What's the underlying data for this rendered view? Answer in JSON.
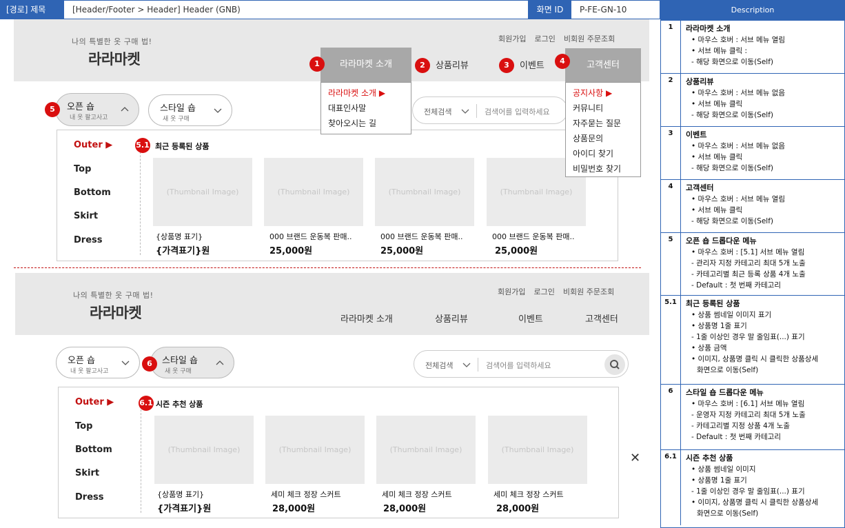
{
  "topbar": {
    "path_label": "[경로] 제목",
    "path": "[Header/Footer > Header] Header (GNB)",
    "id_label": "화면 ID",
    "id": "P-FE-GN-10"
  },
  "header1": {
    "slogan": "나의 특별한 옷 구매 법!",
    "logo": "라라마켓",
    "util": [
      "회원가입",
      "로그인",
      "비회원 주문조회"
    ],
    "nav": [
      "라라마켓 소개",
      "상품리뷰",
      "이벤트",
      "고객센터"
    ],
    "dd_about": [
      "라라마켓 소개 ▶",
      "대표인사말",
      "찾아오시는 길"
    ],
    "dd_cs": [
      "공지사항 ▶",
      "커뮤니티",
      "자주묻는 질문",
      "상품문의",
      "아이디 찾기",
      "비밀번호 찾기"
    ]
  },
  "header2": {
    "slogan": "나의 특별한 옷 구매 법!",
    "logo": "라라마켓",
    "util": [
      "회원가입",
      "로그인",
      "비회원 주문조회"
    ],
    "nav": [
      "라라마켓 소개",
      "상품리뷰",
      "이벤트",
      "고객센터"
    ]
  },
  "badges": [
    "1",
    "2",
    "3",
    "4",
    "5",
    "5.1",
    "6",
    "6.1"
  ],
  "pills": {
    "open": {
      "title": "오픈 숍",
      "sub": "내 옷 팔고사고"
    },
    "style": {
      "title": "스타일 숍",
      "sub": "새 옷 구매"
    }
  },
  "search": {
    "category": "전체검색",
    "placeholder": "검색어를 입력하세요"
  },
  "categories": [
    "Outer ▶",
    "Top",
    "Bottom",
    "Skirt",
    "Dress"
  ],
  "section1": {
    "title": "최근 등록된 상품",
    "thumb": "(Thumbnail Image)",
    "products": [
      {
        "name": "{상품명 표기}",
        "price": "{가격표기}원"
      },
      {
        "name": "000 브랜드 운동복 판매...",
        "price": "25,000원"
      },
      {
        "name": "000 브랜드 운동복 판매...",
        "price": "25,000원"
      },
      {
        "name": "000 브랜드 운동복 판매...",
        "price": "25,000원"
      }
    ]
  },
  "section2": {
    "title": "시즌 추천 상품",
    "thumb": "(Thumbnail Image)",
    "products": [
      {
        "name": "{상품명 표기}",
        "price": "{가격표기}원"
      },
      {
        "name": "세미 체크 정장 스커트",
        "price": "28,000원"
      },
      {
        "name": "세미 체크 정장 스커트",
        "price": "28,000원"
      },
      {
        "name": "세미 체크 정장 스커트",
        "price": "28,000원"
      }
    ]
  },
  "close": "✕",
  "description": {
    "header": "Description",
    "rows": [
      {
        "num": "1",
        "title": "라라마켓 소개",
        "lines": [
          "• 마우스 호버 : 서브 메뉴 열림",
          "• 서브 메뉴 클릭 :",
          "- 해당 화면으로 이동(Self)"
        ]
      },
      {
        "num": "2",
        "title": "상품리뷰",
        "lines": [
          "• 마우스 호버 : 서브 메뉴 없음",
          "• 서브 메뉴 클릭",
          "- 해당 화면으로 이동(Self)"
        ]
      },
      {
        "num": "3",
        "title": "이벤트",
        "lines": [
          "• 마우스 호버 : 서브 메뉴 없음",
          "• 서브 메뉴 클릭",
          "- 해당 화면으로 이동(Self)"
        ]
      },
      {
        "num": "4",
        "title": "고객센터",
        "lines": [
          "• 마우스 호버 : 서브 메뉴 열림",
          "• 서브 메뉴 클릭",
          "- 해당 화면으로 이동(Self)"
        ]
      },
      {
        "num": "5",
        "title": "오픈 숍 드롭다운 메뉴",
        "lines": [
          "• 마우스 호버 : [5.1] 서브 메뉴 열림",
          "- 관리자 지정 카테고리 최대 5개 노출",
          "- 카테고리별 최근 등록 상품  4개 노출",
          "- Default : 첫 번째 카테고리"
        ]
      },
      {
        "num": "5.1",
        "title": "최근 등록된 상품",
        "lines": [
          "• 상품 썸네일 이미지 표기",
          "• 상품명 1줄 표기",
          "- 1줄 이상인 경우 말 줄임표(...) 표기",
          "• 상품 금액",
          "• 이미지, 상품명 클릭 시 클릭한 상품상세",
          "화면으로 이동(Self)"
        ]
      },
      {
        "num": "6",
        "title": "스타일 숍 드롭다운 메뉴",
        "lines": [
          "• 마우스 호버 : [6.1] 서브 메뉴 열림",
          "- 운영자 지정 카테고리 최대 5개 노출",
          "- 카테고리별 지정 상품 4개 노출",
          "- Default : 첫 번째 카테고리"
        ]
      },
      {
        "num": "6.1",
        "title": "시즌 추천 상품",
        "lines": [
          "• 상품 썸네일 이미지",
          "• 상품명 1줄 표기",
          "- 1줄 이상인 경우 말 줄임표(...) 표기",
          "• 이미지, 상품명 클릭 시 클릭한 상품상세",
          "화면으로 이동(Self)"
        ]
      }
    ]
  }
}
